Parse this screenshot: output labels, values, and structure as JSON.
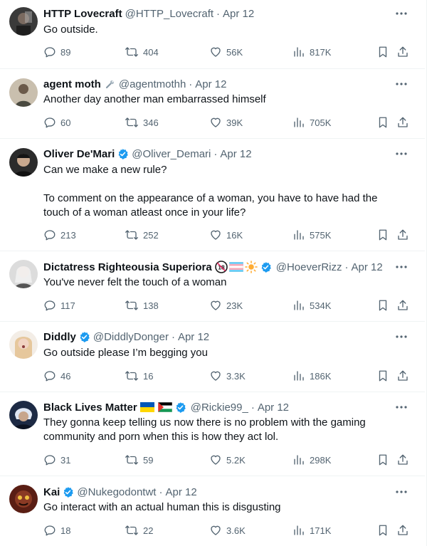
{
  "colors": {
    "verified": "#1d9bf0",
    "secondary_text": "#536471",
    "primary_text": "#0f1419",
    "divider": "#eff3f4"
  },
  "icons": {
    "reply": "speech-bubble-icon",
    "repost": "repost-arrows-icon",
    "like": "heart-icon",
    "views": "bar-chart-icon",
    "bookmark": "bookmark-icon",
    "share": "share-arrow-icon",
    "more": "ellipsis-icon",
    "verified": "verified-badge-icon"
  },
  "tweets": [
    {
      "name": "HTTP Lovecraft",
      "handle": "@HTTP_Lovecraft",
      "sep": "·",
      "date": "Apr 12",
      "text": "Go outside.",
      "stats": {
        "reply": "89",
        "repost": "404",
        "like": "56K",
        "views": "817K"
      }
    },
    {
      "name": "agent moth",
      "handle": "@agentmothh",
      "sep": "·",
      "date": "Apr 12",
      "text": "Another day another man embarrassed himself",
      "stats": {
        "reply": "60",
        "repost": "346",
        "like": "39K",
        "views": "705K"
      }
    },
    {
      "name": "Oliver De'Mari",
      "handle": "@Oliver_Demari",
      "sep": "·",
      "date": "Apr 12",
      "text": "Can we make a new rule?\n\nTo comment on the appearance of a woman, you have to have had the touch of a woman atleast once in your life?",
      "stats": {
        "reply": "213",
        "repost": "252",
        "like": "16K",
        "views": "575K"
      }
    },
    {
      "name": "Dictatress Righteousia Superiora",
      "handle": "@HoeverRizz",
      "sep": "·",
      "date": "Apr 12",
      "age_badge": "18",
      "text": "You've never felt the touch of a woman",
      "stats": {
        "reply": "117",
        "repost": "138",
        "like": "23K",
        "views": "534K"
      }
    },
    {
      "name": "Diddly",
      "handle": "@DiddlyDonger",
      "sep": "·",
      "date": "Apr 12",
      "text": "Go outside please I’m begging you",
      "stats": {
        "reply": "46",
        "repost": "16",
        "like": "3.3K",
        "views": "186K"
      }
    },
    {
      "name": "Black Lives Matter",
      "handle": "@Rickie99_",
      "sep": "·",
      "date": "Apr 12",
      "text": "They gonna keep telling us now there is no problem with the gaming community and porn when this is how they act lol.",
      "stats": {
        "reply": "31",
        "repost": "59",
        "like": "5.2K",
        "views": "298K"
      }
    },
    {
      "name": "Kai",
      "handle": "@Nukegodontwt",
      "sep": "·",
      "date": "Apr 12",
      "text": "Go interact with an actual human this is disgusting",
      "stats": {
        "reply": "18",
        "repost": "22",
        "like": "3.6K",
        "views": "171K"
      }
    }
  ]
}
